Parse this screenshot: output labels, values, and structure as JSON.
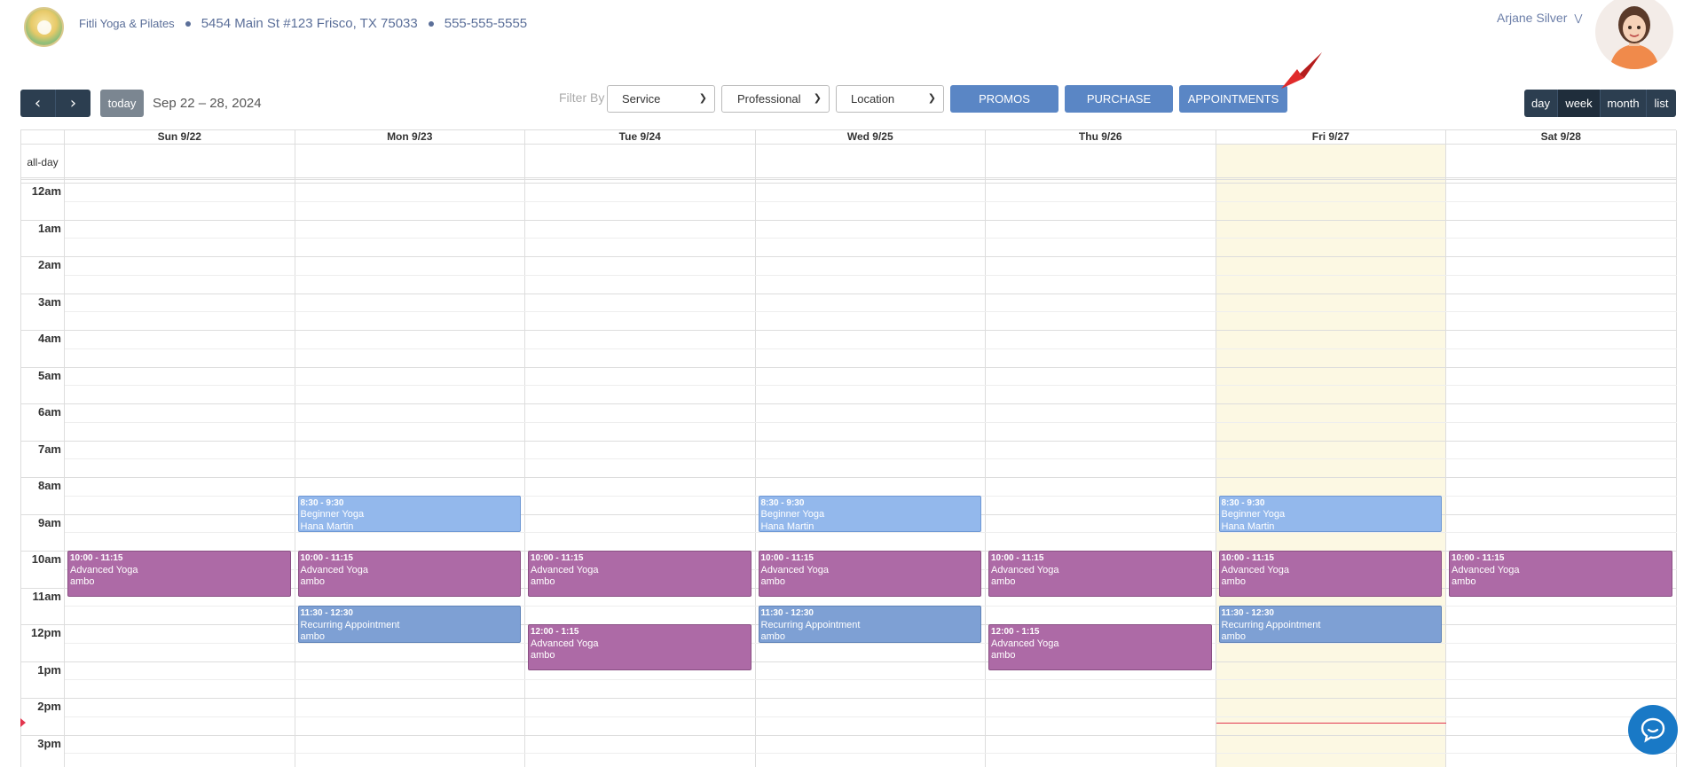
{
  "header": {
    "business_name": "Fitli Yoga & Pilates",
    "address": "5454 Main St #123 Frisco, TX 75033",
    "phone": "555-555-5555",
    "user_name": "Arjane Silver"
  },
  "toolbar": {
    "prev_icon": "chevron-left-icon",
    "next_icon": "chevron-right-icon",
    "today_label": "today",
    "date_range": "Sep 22 – 28, 2024",
    "filter_label": "Filter By",
    "service_select": "Service",
    "professional_select": "Professional",
    "location_select": "Location",
    "promos_label": "PROMOS",
    "purchase_label": "PURCHASE",
    "appointments_label": "APPOINTMENTS",
    "views": [
      "day",
      "week",
      "month",
      "list"
    ],
    "active_view": "week"
  },
  "calendar": {
    "allday_label": "all-day",
    "days": [
      "Sun 9/22",
      "Mon 9/23",
      "Tue 9/24",
      "Wed 9/25",
      "Thu 9/26",
      "Fri 9/27",
      "Sat 9/28"
    ],
    "today_index": 5,
    "hours": [
      "12am",
      "1am",
      "2am",
      "3am",
      "4am",
      "5am",
      "6am",
      "7am",
      "8am",
      "9am",
      "10am",
      "11am",
      "12pm",
      "1pm",
      "2pm",
      "3pm"
    ],
    "now_hour": 14.67,
    "events": [
      {
        "day": 1,
        "start": 8.5,
        "end": 9.5,
        "time": "8:30 - 9:30",
        "title": "Beginner Yoga",
        "person": "Hana Martin",
        "kind": "beginner"
      },
      {
        "day": 3,
        "start": 8.5,
        "end": 9.5,
        "time": "8:30 - 9:30",
        "title": "Beginner Yoga",
        "person": "Hana Martin",
        "kind": "beginner"
      },
      {
        "day": 5,
        "start": 8.5,
        "end": 9.5,
        "time": "8:30 - 9:30",
        "title": "Beginner Yoga",
        "person": "Hana Martin",
        "kind": "beginner"
      },
      {
        "day": 0,
        "start": 10.0,
        "end": 11.25,
        "time": "10:00 - 11:15",
        "title": "Advanced Yoga",
        "person": "ambo",
        "kind": "advanced"
      },
      {
        "day": 1,
        "start": 10.0,
        "end": 11.25,
        "time": "10:00 - 11:15",
        "title": "Advanced Yoga",
        "person": "ambo",
        "kind": "advanced"
      },
      {
        "day": 2,
        "start": 10.0,
        "end": 11.25,
        "time": "10:00 - 11:15",
        "title": "Advanced Yoga",
        "person": "ambo",
        "kind": "advanced"
      },
      {
        "day": 3,
        "start": 10.0,
        "end": 11.25,
        "time": "10:00 - 11:15",
        "title": "Advanced Yoga",
        "person": "ambo",
        "kind": "advanced"
      },
      {
        "day": 4,
        "start": 10.0,
        "end": 11.25,
        "time": "10:00 - 11:15",
        "title": "Advanced Yoga",
        "person": "ambo",
        "kind": "advanced"
      },
      {
        "day": 5,
        "start": 10.0,
        "end": 11.25,
        "time": "10:00 - 11:15",
        "title": "Advanced Yoga",
        "person": "ambo",
        "kind": "advanced"
      },
      {
        "day": 6,
        "start": 10.0,
        "end": 11.25,
        "time": "10:00 - 11:15",
        "title": "Advanced Yoga",
        "person": "ambo",
        "kind": "advanced"
      },
      {
        "day": 1,
        "start": 11.5,
        "end": 12.5,
        "time": "11:30 - 12:30",
        "title": "Recurring Appointment",
        "person": "ambo",
        "kind": "recurring"
      },
      {
        "day": 3,
        "start": 11.5,
        "end": 12.5,
        "time": "11:30 - 12:30",
        "title": "Recurring Appointment",
        "person": "ambo",
        "kind": "recurring"
      },
      {
        "day": 5,
        "start": 11.5,
        "end": 12.5,
        "time": "11:30 - 12:30",
        "title": "Recurring Appointment",
        "person": "ambo",
        "kind": "recurring"
      },
      {
        "day": 2,
        "start": 12.0,
        "end": 13.25,
        "time": "12:00 - 1:15",
        "title": "Advanced Yoga",
        "person": "ambo",
        "kind": "advanced"
      },
      {
        "day": 4,
        "start": 12.0,
        "end": 13.25,
        "time": "12:00 - 1:15",
        "title": "Advanced Yoga",
        "person": "ambo",
        "kind": "advanced"
      }
    ]
  },
  "colors": {
    "beginner": "#93b8ec",
    "advanced": "#ad6aa6",
    "recurring": "#7ea0d4",
    "today_bg": "#fcf8e3",
    "now_indicator": "#e2364e",
    "primary_button": "#5a86c5"
  },
  "icons": {
    "chat": "chat-bubble-icon",
    "annotation": "red-arrow-icon",
    "user_caret": "double-chevron-down-icon"
  }
}
